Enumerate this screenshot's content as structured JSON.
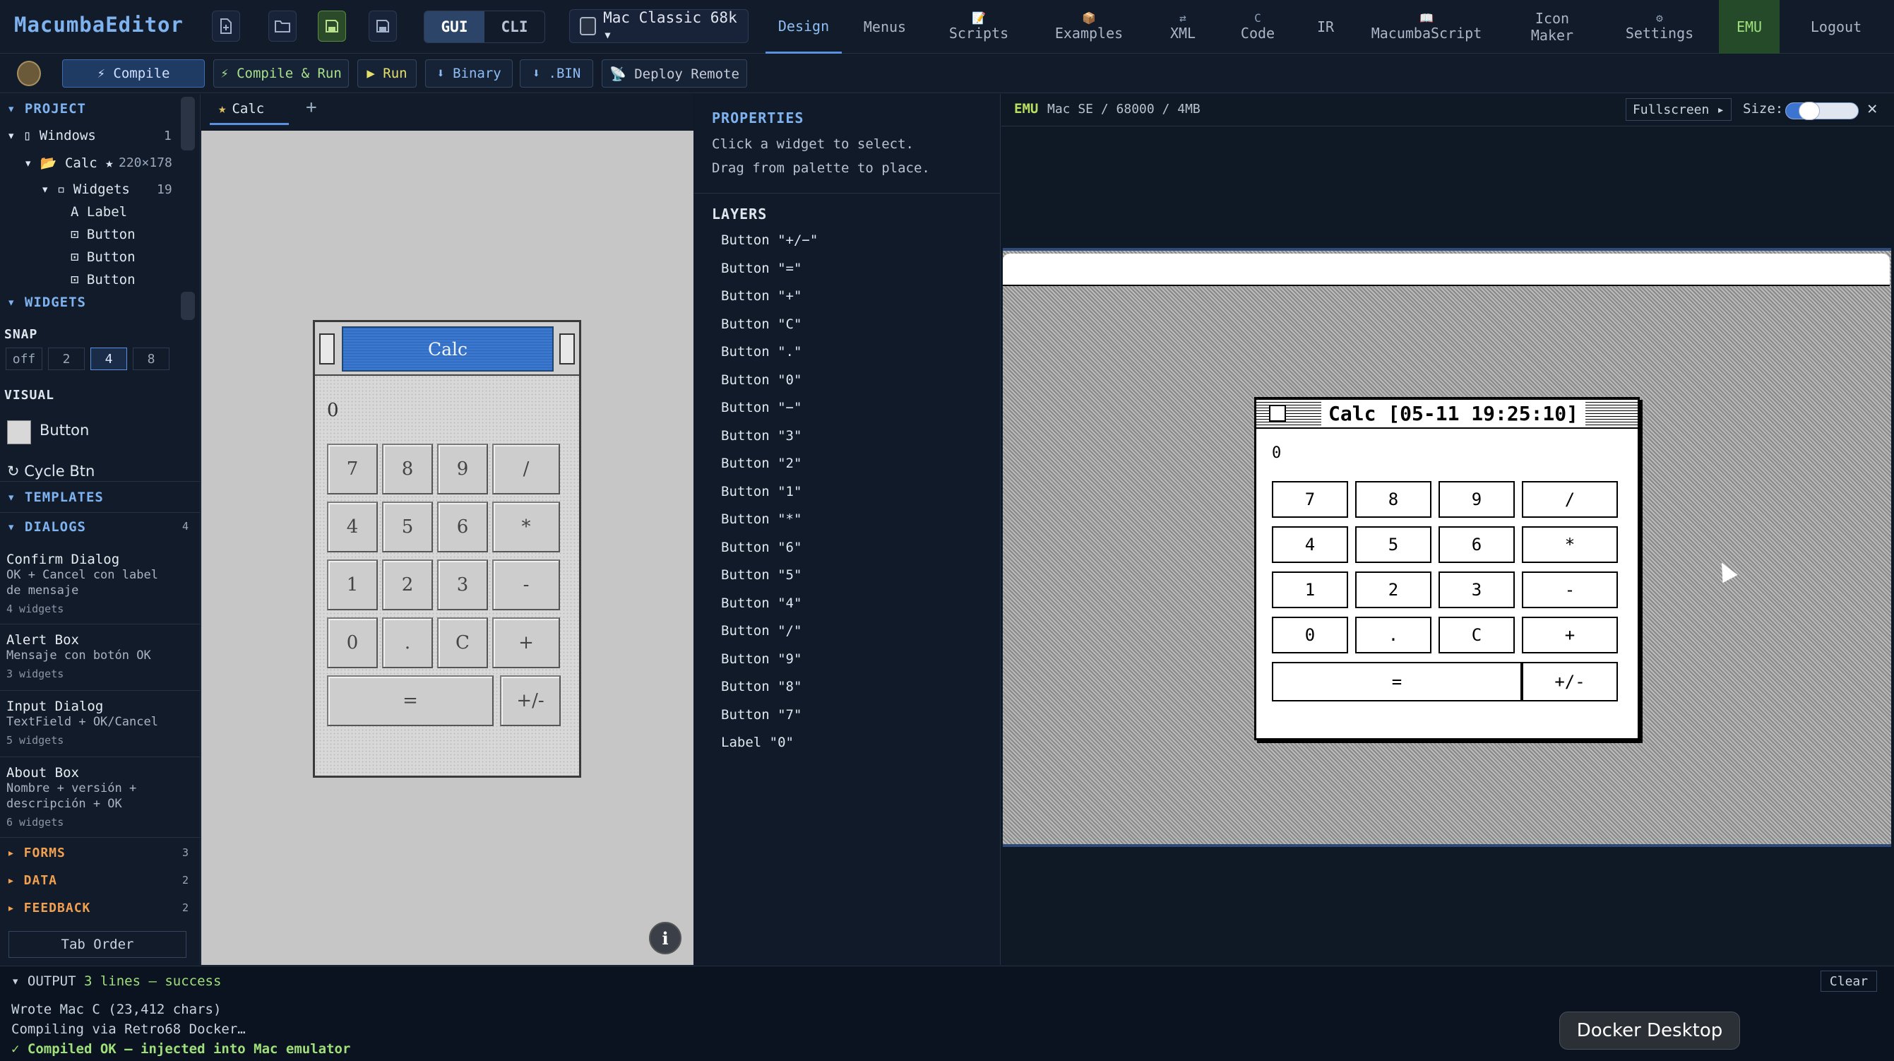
{
  "app": {
    "logo": "MacumbaEditor"
  },
  "mode": {
    "gui": "GUI",
    "cli": "CLI"
  },
  "platform": {
    "label": "Mac Classic 68k ▾"
  },
  "nav": {
    "design": "Design",
    "menus": "Menus",
    "scripts": "Scripts",
    "examples": "Examples",
    "xml_icon": "⇄",
    "xml": "XML",
    "ccode_top": "C",
    "ccode": "Code",
    "ir": "IR",
    "macumbascript": "MacumbaScript",
    "icon_maker_1": "Icon",
    "icon_maker_2": "Maker",
    "settings_icon": "⚙",
    "settings": "Settings",
    "emu": "EMU",
    "logout": "Logout"
  },
  "toolbar": {
    "compile": "⚡ Compile",
    "compile_run": "⚡ Compile & Run",
    "run": "▶ Run",
    "binary": "⬇ Binary",
    "bin": "⬇ .BIN",
    "deploy": "📡 Deploy Remote"
  },
  "sidebar": {
    "project": "▾ PROJECT",
    "windows": "▾ ▯ Windows",
    "windows_count": "1",
    "calc": "▾ 📂 Calc ★",
    "calc_size": "220×178",
    "widgets": "▾ ▫ Widgets",
    "widgets_count": "19",
    "tree_items": [
      "A Label",
      "⊡ Button",
      "⊡ Button",
      "⊡ Button"
    ],
    "widgets_section": "▾ WIDGETS",
    "snap": "SNAP",
    "snap_options": [
      "off",
      "2",
      "4",
      "8"
    ],
    "visual": "VISUAL",
    "visual_button": "Button",
    "cycle_btn": "↻ Cycle Btn",
    "templates": "▾ TEMPLATES",
    "dialogs": "▾ DIALOGS",
    "dialogs_count": "4",
    "templates_list": [
      {
        "name": "Confirm Dialog",
        "desc1": "OK + Cancel con label",
        "desc2": "de mensaje",
        "widgets": "4 widgets"
      },
      {
        "name": "Alert Box",
        "desc1": "Mensaje con botón OK",
        "desc2": "",
        "widgets": "3 widgets"
      },
      {
        "name": "Input Dialog",
        "desc1": "TextField + OK/Cancel",
        "desc2": "",
        "widgets": "5 widgets"
      },
      {
        "name": "About Box",
        "desc1": "Nombre + versión +",
        "desc2": "descripción + OK",
        "widgets": "6 widgets"
      }
    ],
    "forms": "▸ FORMS",
    "forms_count": "3",
    "data": "▸ DATA",
    "data_count": "2",
    "feedback": "▸ FEEDBACK",
    "feedback_count": "2",
    "tab_order": "Tab Order"
  },
  "design": {
    "tab": "Calc",
    "tab_star": "★",
    "add_tab": "+",
    "window_title": "Calc",
    "display": "0",
    "keys": [
      "7",
      "8",
      "9",
      "/",
      "4",
      "5",
      "6",
      "*",
      "1",
      "2",
      "3",
      "-",
      "0",
      ".",
      "C",
      "+",
      "=",
      "+/-"
    ],
    "info": "i"
  },
  "properties": {
    "title": "PROPERTIES",
    "help1": "Click a widget to select.",
    "help2": "Drag from palette to place.",
    "layers_title": "LAYERS",
    "layers": [
      "Button \"+/−\"",
      "Button \"=\"",
      "Button \"+\"",
      "Button \"C\"",
      "Button \".\"",
      "Button \"0\"",
      "Button \"−\"",
      "Button \"3\"",
      "Button \"2\"",
      "Button \"1\"",
      "Button \"*\"",
      "Button \"6\"",
      "Button \"5\"",
      "Button \"4\"",
      "Button \"/\"",
      "Button \"9\"",
      "Button \"8\"",
      "Button \"7\"",
      "Label \"0\""
    ]
  },
  "emu": {
    "tag": "EMU",
    "info": "Mac SE / 68000 / 4MB",
    "fullscreen": "Fullscreen ▸",
    "size_label": "Size:",
    "size_value": 0.25,
    "close": "✕",
    "window_title": "Calc [05-11 19:25:10]",
    "display": "0",
    "keys": [
      "7",
      "8",
      "9",
      "/",
      "4",
      "5",
      "6",
      "*",
      "1",
      "2",
      "3",
      "-",
      "0",
      ".",
      "C",
      "+",
      "=",
      "+/-"
    ]
  },
  "output": {
    "head": "▾ OUTPUT",
    "status": "3 lines — success",
    "lines": [
      "Wrote Mac C (23,412 chars)",
      "Compiling via Retro68 Docker…",
      "✓ Compiled OK — injected into Mac emulator"
    ],
    "clear": "Clear"
  },
  "docker_tooltip": "Docker Desktop",
  "colors": {
    "accent": "#7fb3f0",
    "success": "#9fe07a",
    "emu_bg": "#254a2a"
  }
}
